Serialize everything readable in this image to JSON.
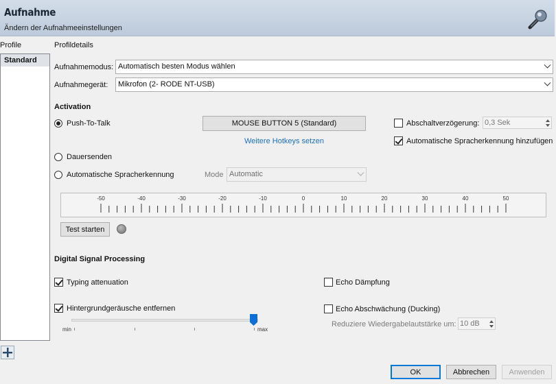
{
  "header": {
    "title": "Aufnahme",
    "subtitle": "Ändern der Aufnahmeeinstellungen",
    "icon": "microphone-icon"
  },
  "profiles": {
    "label": "Profile",
    "items": [
      "Standard"
    ]
  },
  "details": {
    "label": "Profildetails",
    "mode_label": "Aufnahmemodus:",
    "mode_value": "Automatisch besten Modus wählen",
    "device_label": "Aufnahmegerät:",
    "device_value": "Mikrofon (2- RODE NT-USB)"
  },
  "activation": {
    "heading": "Activation",
    "ptt_label": "Push-To-Talk",
    "ptt_selected": true,
    "hotkey_button": "MOUSE BUTTON 5 (Standard)",
    "more_hotkeys_link": "Weitere Hotkeys setzen",
    "delay_label": "Abschaltverzögerung:",
    "delay_value": "0,3 Sek",
    "auto_detect_label": "Automatische Spracherkennung hinzufügen",
    "continuous_label": "Dauersenden",
    "vad_label": "Automatische Spracherkennung",
    "vad_mode_label": "Mode",
    "vad_mode_value": "Automatic"
  },
  "meter": {
    "scale": [
      "-50",
      "-40",
      "-30",
      "-20",
      "-10",
      "0",
      "10",
      "20",
      "30",
      "40",
      "50"
    ],
    "test_button": "Test starten"
  },
  "dsp": {
    "heading": "Digital Signal Processing",
    "typing_label": "Typing attenuation",
    "typing_checked": true,
    "noise_label": "Hintergrundgeräusche entfernen",
    "noise_checked": true,
    "noise_level": 1.0,
    "slider_min": "min",
    "slider_max": "max",
    "echo_label": "Echo Dämpfung",
    "echo_checked": false,
    "ducking_label": "Echo Abschwächung (Ducking)",
    "ducking_checked": false,
    "reduce_label": "Reduziere Wiedergabelautstärke um:",
    "reduce_value": "10 dB"
  },
  "footer": {
    "add_icon": "plus-icon",
    "ok": "OK",
    "cancel": "Abbrechen",
    "apply": "Anwenden"
  },
  "colors": {
    "accent": "#0078d7",
    "link": "#1c6fb8",
    "header_bg": "#c6d2e0"
  }
}
